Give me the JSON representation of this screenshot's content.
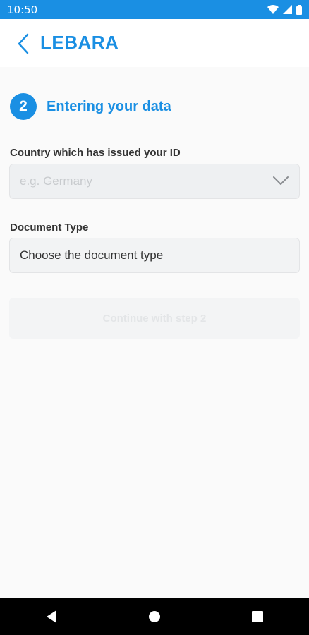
{
  "status_bar": {
    "time": "10:50"
  },
  "header": {
    "brand": "LEBARA"
  },
  "step": {
    "number": "2",
    "title": "Entering your data"
  },
  "country_field": {
    "label": "Country which has issued your ID",
    "placeholder": "e.g. Germany"
  },
  "document_field": {
    "label": "Document Type",
    "value": "Choose the document type"
  },
  "continue_button": {
    "label": "Continue with step 2"
  },
  "colors": {
    "accent": "#1a8fe3",
    "nav_bar": "#000000",
    "disabled_text": "#c8cbce"
  },
  "icons": {
    "status": [
      "wifi-icon",
      "signal-icon",
      "battery-icon"
    ],
    "nav": [
      "back-triangle-icon",
      "home-circle-icon",
      "recents-square-icon"
    ]
  }
}
